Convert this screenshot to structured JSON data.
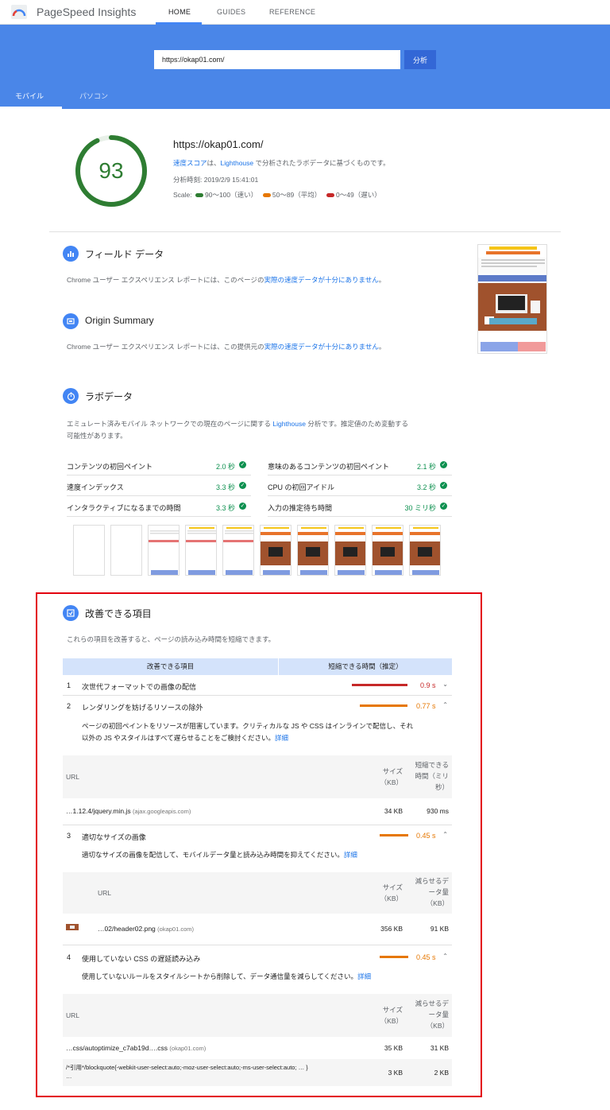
{
  "app": {
    "name": "PageSpeed Insights",
    "nav": [
      "HOME",
      "GUIDES",
      "REFERENCE"
    ]
  },
  "search": {
    "url_value": "https://okap01.com/",
    "analyze_label": "分析"
  },
  "device_tabs": [
    "モバイル",
    "パソコン"
  ],
  "score": {
    "value": "93",
    "value_fraction": 0.93,
    "url": "https://okap01.com/",
    "desc_link1": "速度スコア",
    "desc_mid": "は、",
    "desc_link2": "Lighthouse",
    "desc_tail": " で分析されたラボデータに基づくものです。",
    "time": "分析時刻: 2019/2/9 15:41:01",
    "scale_label": "Scale:",
    "scale_fast": "90～100（速い）",
    "scale_avg": "50～89（平均）",
    "scale_slow": "0～49（遅い）",
    "colors": {
      "fast": "#2e7d32",
      "average": "#e67700",
      "slow": "#c62828"
    }
  },
  "field": {
    "title": "フィールド データ",
    "text": "Chrome ユーザー エクスペリエンス レポートには、このページの",
    "link": "実際の速度データが十分にありません",
    "end": "。"
  },
  "origin": {
    "title": "Origin Summary",
    "text": "Chrome ユーザー エクスペリエンス レポートには、この提供元の",
    "link": "実際の速度データが十分にありません",
    "end": "。"
  },
  "lab": {
    "title": "ラボデータ",
    "desc1": "エミュレート済みモバイル ネットワークでの現在のページに関する ",
    "desc_link": "Lighthouse",
    "desc2": " 分析です。推定値のため変動する",
    "desc3": "可能性があります。",
    "metrics_left": [
      {
        "label": "コンテンツの初回ペイント",
        "value": "2.0 秒"
      },
      {
        "label": "速度インデックス",
        "value": "3.3 秒"
      },
      {
        "label": "インタラクティブになるまでの時間",
        "value": "3.3 秒"
      }
    ],
    "metrics_right": [
      {
        "label": "意味のあるコンテンツの初回ペイント",
        "value": "2.1 秒"
      },
      {
        "label": "CPU の初回アイドル",
        "value": "3.2 秒"
      },
      {
        "label": "入力の推定待ち時間",
        "value": "30 ミリ秒"
      }
    ]
  },
  "opportunities": {
    "title": "改善できる項目",
    "desc": "これらの項目を改善すると、ページの読み込み時間を短縮できます。",
    "col1": "改善できる項目",
    "col2": "短縮できる時間（推定）",
    "items": [
      {
        "num": "1",
        "title": "次世代フォーマットでの画像の配信",
        "saving": "0.9 s",
        "chev": "⌄"
      },
      {
        "num": "2",
        "title": "レンダリングを妨げるリソースの除外",
        "saving": "0.77 s",
        "chev": "⌃"
      },
      {
        "num": "3",
        "title": "適切なサイズの画像",
        "saving": "0.45 s",
        "chev": "⌃"
      },
      {
        "num": "4",
        "title": "使用していない CSS の遅延読み込み",
        "saving": "0.45 s",
        "chev": "⌃"
      }
    ],
    "item2_desc1": "ページの初回ペイントをリソースが阻害しています。クリティカルな JS や CSS はインラインで配信し、それ",
    "item2_desc2": "以外の JS やスタイルはすべて遅らせることをご検討ください。",
    "item3_desc": "適切なサイズの画像を配信して、モバイルデータ量と読み込み時間を抑えてください。",
    "item4_desc": "使用していないルールをスタイルシートから削除して、データ通信量を減らしてください。",
    "detail_link": "詳細",
    "table2": {
      "h_url": "URL",
      "h_size1": "サイズ",
      "h_size2": "（KB）",
      "h_save1": "短縮できる",
      "h_save2": "時間（ミリ",
      "h_save3": "秒）",
      "row_url": "…1.12.4/jquery.min.js",
      "row_host": "(ajax.googleapis.com)",
      "row_size": "34 KB",
      "row_save": "930 ms"
    },
    "table3": {
      "h_url": "URL",
      "h_size1": "サイズ",
      "h_size2": "（KB）",
      "h_save1": "減らせるデ",
      "h_save2": "ータ量",
      "h_save3": "（KB）",
      "row_url": "…02/header02.png",
      "row_host": "(okap01.com)",
      "row_size": "356 KB",
      "row_save": "91 KB"
    },
    "table4": {
      "h_url": "URL",
      "h_size1": "サイズ",
      "h_size2": "（KB）",
      "h_save1": "減らせるデ",
      "h_save2": "ータ量",
      "h_save3": "（KB）",
      "row1_url": "…css/autoptimize_c7ab19d….css",
      "row1_host": "(okap01.com)",
      "row1_size": "35 KB",
      "row1_save": "31 KB",
      "row2_code": "/*引用*/blockquote{-webkit-user-select:auto;-moz-user-select:auto;-ms-user-select:auto; … }",
      "row2_more": "…",
      "row2_size": "3 KB",
      "row2_save": "2 KB"
    }
  }
}
